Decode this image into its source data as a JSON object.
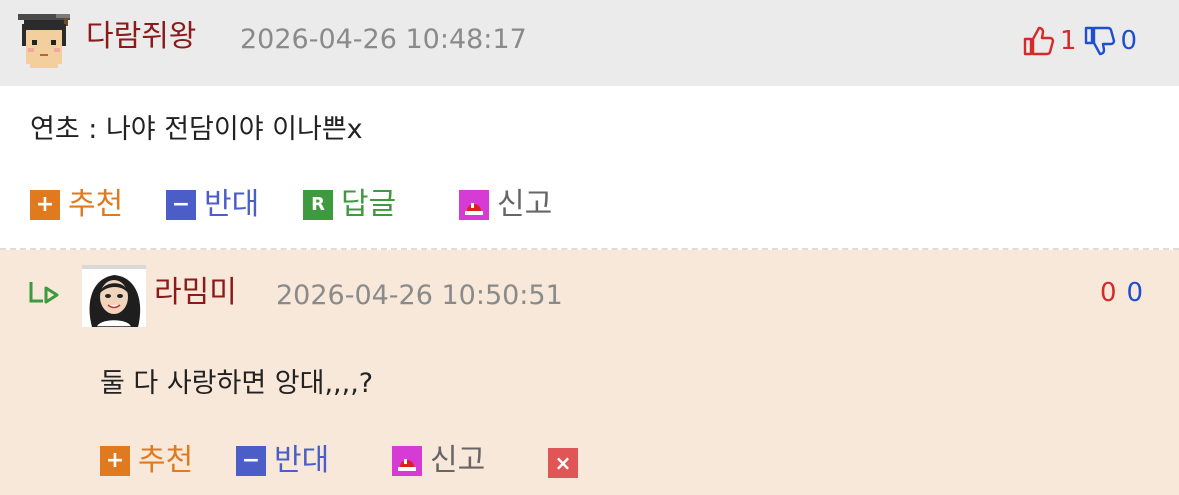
{
  "comments": [
    {
      "nickname": "다람쥐왕",
      "date": "2026-04-26 10:48:17",
      "content": "연초 : 나야 전담이야 이나쁜x",
      "up_count": "1",
      "down_count": "0",
      "actions": {
        "recommend_label": "추천",
        "oppose_label": "반대",
        "reply_label": "답글",
        "report_label": "신고"
      }
    },
    {
      "nickname": "라밈미",
      "date": "2026-04-26 10:50:51",
      "content": "둘 다 사랑하면 앙대,,,,?",
      "up_count": "0",
      "down_count": "0",
      "actions": {
        "recommend_label": "추천",
        "oppose_label": "반대",
        "report_label": "신고"
      }
    }
  ],
  "icons": {
    "avatar1": "pixel-face-avatar",
    "avatar2": "woman-portrait-avatar",
    "thumb_up": "thumbs-up-icon",
    "thumb_down": "thumbs-down-icon",
    "plus": "plus-icon",
    "minus": "minus-icon",
    "reply": "reply-r-icon",
    "report": "siren-icon",
    "delete": "close-x-icon",
    "reply_arrow": "reply-arrow-icon"
  },
  "colors": {
    "header_bg": "#ebebeb",
    "reply_bg": "#f7e8d9",
    "nickname": "#8b1a1a",
    "recommend": "#e07a1e",
    "oppose": "#4b5ec7",
    "reply": "#3e9a3e",
    "up_count": "#d42a2a",
    "down_count": "#1e4fd0"
  }
}
